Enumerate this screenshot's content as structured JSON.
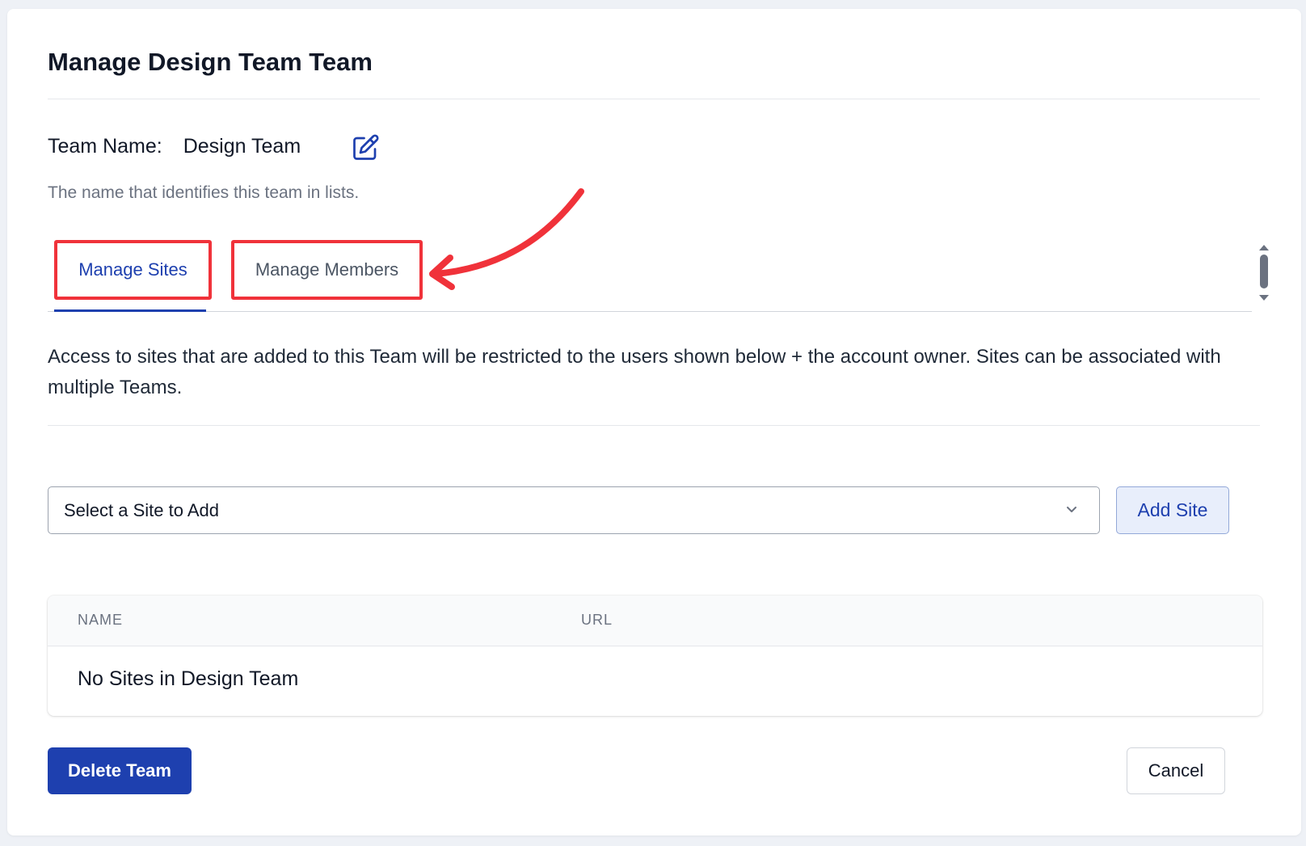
{
  "modal": {
    "title": "Manage Design Team Team"
  },
  "team": {
    "name_label": "Team Name:",
    "name_value": "Design Team",
    "help_text": "The name that identifies this team in lists."
  },
  "tabs": [
    {
      "label": "Manage Sites",
      "active": true
    },
    {
      "label": "Manage Members",
      "active": false
    }
  ],
  "description": "Access to sites that are added to this Team will be restricted to the users shown below + the account owner. Sites can be associated with multiple Teams.",
  "site_select": {
    "selected": "Select a Site to Add"
  },
  "add_site_label": "Add Site",
  "table": {
    "columns": [
      "NAME",
      "URL"
    ],
    "empty_message": "No Sites in Design Team"
  },
  "footer": {
    "delete_label": "Delete Team",
    "cancel_label": "Cancel"
  },
  "colors": {
    "primary": "#1e40af",
    "annotation": "#f0323a"
  },
  "icons": {
    "edit": "edit-icon",
    "chevron": "chevron-down-icon"
  }
}
